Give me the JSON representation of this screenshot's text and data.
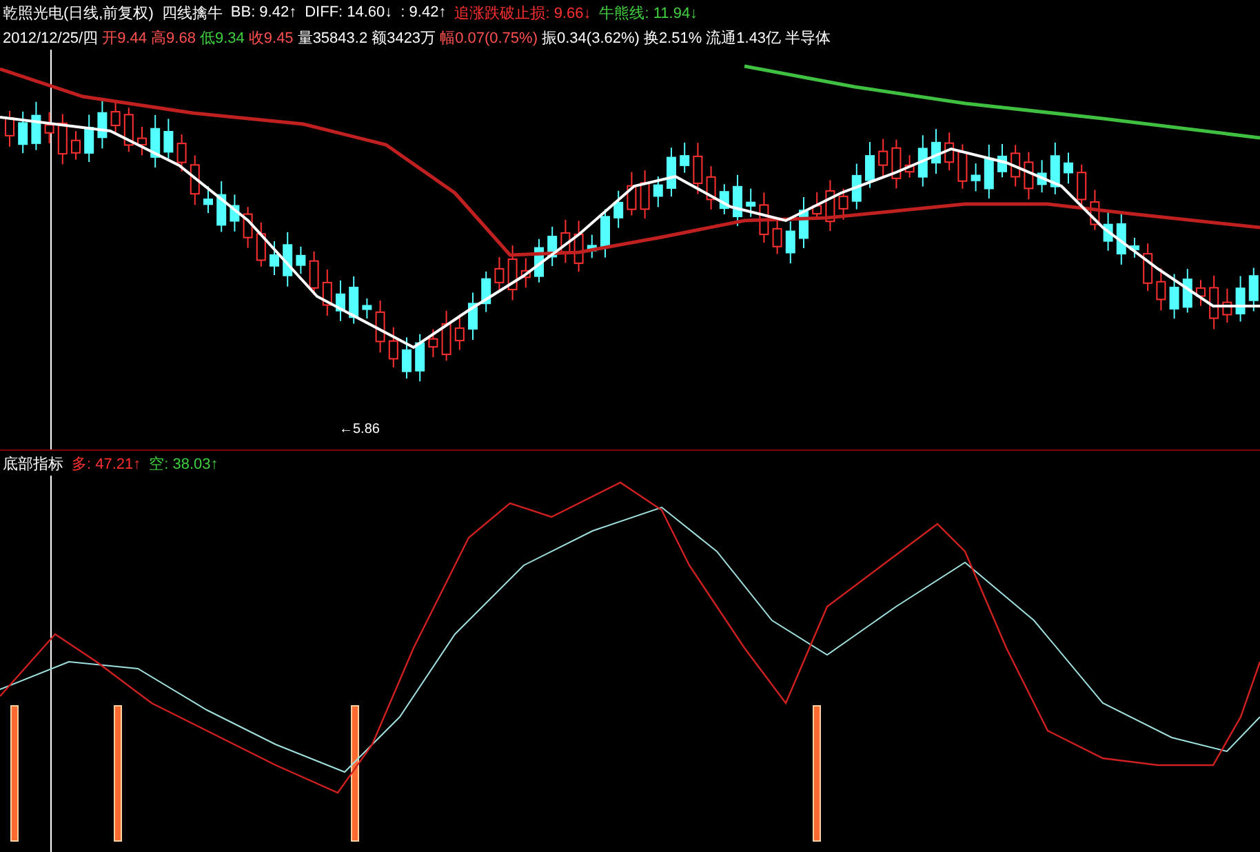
{
  "title_bar": {
    "stock": "乾照光电(日线,前复权)",
    "indicator": "四线擒牛",
    "values": [
      {
        "text": "BB: 9.42↑",
        "color": "#ffffff"
      },
      {
        "text": "DIFF: 14.60↓",
        "color": "#ffffff"
      },
      {
        "text": ": 9.42↑",
        "color": "#ffffff"
      },
      {
        "text": "追涨跌破止损: 9.66↓",
        "color": "#ff3030"
      },
      {
        "text": "牛熊线: 11.94↓",
        "color": "#40d040"
      }
    ]
  },
  "quote_line": {
    "date": "2012/12/25/四",
    "items": [
      {
        "text": "开9.44",
        "color": "#ff5050"
      },
      {
        "text": "高9.68",
        "color": "#ff5050"
      },
      {
        "text": "低9.34",
        "color": "#40d040"
      },
      {
        "text": "收9.45",
        "color": "#ff5050"
      },
      {
        "text": "量35843.2",
        "color": "#ffffff"
      },
      {
        "text": "额3423万",
        "color": "#ffffff"
      },
      {
        "text": "幅0.07(0.75%)",
        "color": "#ff5050"
      },
      {
        "text": "振0.34(3.62%)",
        "color": "#ffffff"
      },
      {
        "text": "换2.51%",
        "color": "#ffffff"
      },
      {
        "text": "流通1.43亿",
        "color": "#ffffff"
      },
      {
        "text": "半导体",
        "color": "#ffffff"
      }
    ]
  },
  "price_chart": {
    "low_marker": "←5.86"
  },
  "indicator_pane": {
    "name": "底部指标",
    "values": [
      {
        "text": "多: 47.21↑",
        "color": "#ff3030"
      },
      {
        "text": "空: 38.03↑",
        "color": "#40d040"
      }
    ]
  }
}
